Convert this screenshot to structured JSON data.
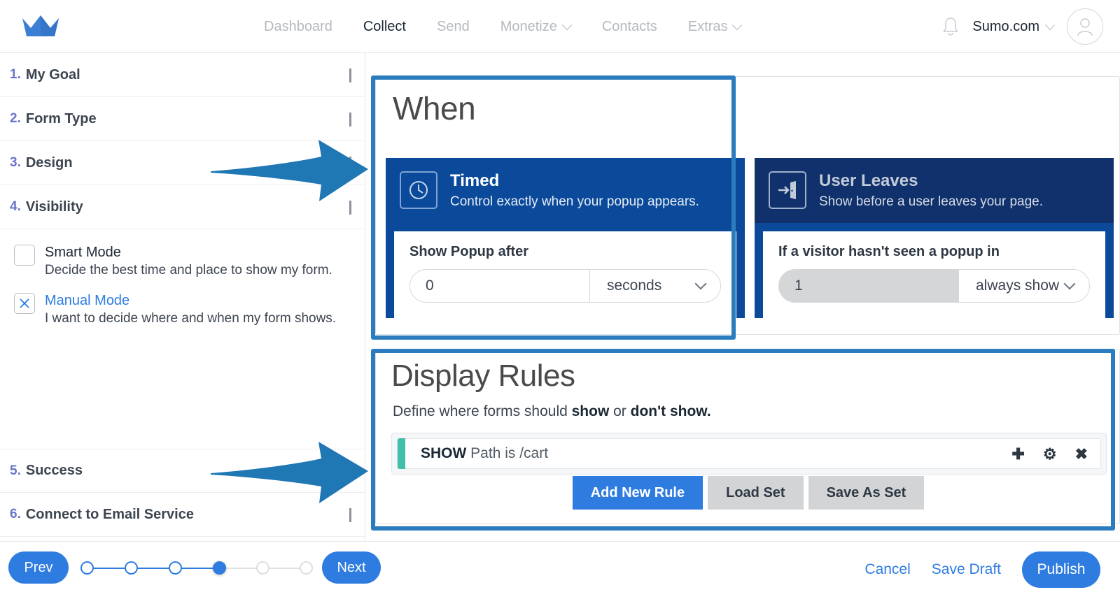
{
  "header": {
    "logo_icon": "crown-icon",
    "nav": [
      {
        "label": "Dashboard",
        "active": false,
        "caret": false
      },
      {
        "label": "Collect",
        "active": true,
        "caret": false
      },
      {
        "label": "Send",
        "active": false,
        "caret": false
      },
      {
        "label": "Monetize",
        "active": false,
        "caret": true
      },
      {
        "label": "Contacts",
        "active": false,
        "caret": false
      },
      {
        "label": "Extras",
        "active": false,
        "caret": true
      }
    ],
    "bell_icon": "notification-bell-icon",
    "account_name": "Sumo.com",
    "account_caret_icon": "chevron-down-icon",
    "avatar_icon": "user-avatar-icon"
  },
  "sidebar": {
    "steps": [
      {
        "num": "1.",
        "label": "My Goal",
        "chevron": "chevron-right-icon"
      },
      {
        "num": "2.",
        "label": "Form Type",
        "chevron": "chevron-right-icon"
      },
      {
        "num": "3.",
        "label": "Design",
        "chevron": "chevron-right-icon"
      },
      {
        "num": "4.",
        "label": "Visibility",
        "chevron": "chevron-down-icon"
      }
    ],
    "steps_bottom": [
      {
        "num": "5.",
        "label": "Success",
        "chevron": ""
      },
      {
        "num": "6.",
        "label": "Connect to Email Service",
        "chevron": "chevron-right-icon"
      }
    ],
    "modes": [
      {
        "title": "Smart Mode",
        "desc": "Decide the best time and place to show my form.",
        "checked": false
      },
      {
        "title": "Manual Mode",
        "desc": "I want to decide where and when my form shows.",
        "checked": true
      }
    ]
  },
  "when": {
    "title": "When",
    "options": [
      {
        "name": "Timed",
        "desc": "Control exactly when your popup appears.",
        "icon": "clock-icon",
        "selected": true,
        "field_label": "Show Popup after",
        "input_value": "0",
        "select_value": "seconds"
      },
      {
        "name": "User Leaves",
        "desc": "Show before a user leaves your page.",
        "icon": "exit-door-icon",
        "selected": false,
        "field_label": "If a visitor hasn't seen a popup in",
        "input_value": "1",
        "select_value": "always show"
      }
    ]
  },
  "display_rules": {
    "title": "Display Rules",
    "subtitle_prefix": "Define where forms should ",
    "subtitle_bold1": "show",
    "subtitle_mid": " or ",
    "subtitle_bold2": "don't show.",
    "rules": [
      {
        "action": "SHOW",
        "condition": "Path is /cart",
        "bar_color": "#41c0a9"
      }
    ],
    "row_icons": [
      {
        "name": "add-icon",
        "glyph": "✚"
      },
      {
        "name": "settings-gear-icon",
        "glyph": "⚙"
      },
      {
        "name": "close-icon",
        "glyph": "✖"
      }
    ],
    "buttons": [
      {
        "label": "Add New Rule",
        "style": "primary"
      },
      {
        "label": "Load Set",
        "style": "grey"
      },
      {
        "label": "Save As Set",
        "style": "grey"
      }
    ]
  },
  "footer": {
    "prev_label": "Prev",
    "next_label": "Next",
    "stepper": {
      "total": 6,
      "current": 4
    },
    "cancel_label": "Cancel",
    "save_draft_label": "Save Draft",
    "publish_label": "Publish"
  },
  "colors": {
    "accent_blue": "#2f7ce0",
    "highlight_blue": "#2a7cbf",
    "card_navy": "#0b4a9b",
    "card_navy_dark": "#10316b",
    "rule_green": "#41c0a9",
    "step_num_purple": "#6a74c9"
  }
}
